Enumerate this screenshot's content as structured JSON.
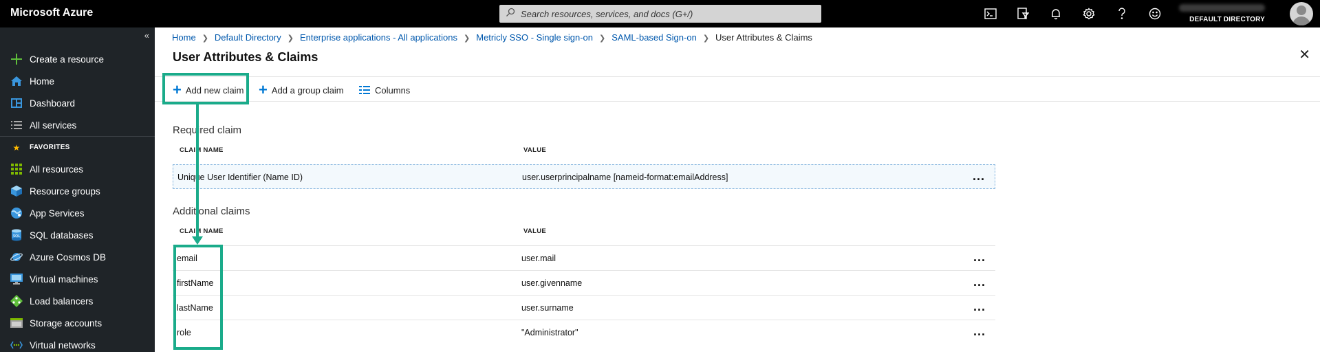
{
  "app": {
    "brand": "Microsoft Azure"
  },
  "search": {
    "placeholder": "Search resources, services, and docs (G+/)"
  },
  "header_icons": [
    "cloud-shell-icon",
    "directory-filter-icon",
    "notifications-icon",
    "settings-icon",
    "help-icon",
    "feedback-icon"
  ],
  "user": {
    "directory": "DEFAULT DIRECTORY"
  },
  "sidebar": {
    "collapse_glyph": "«",
    "items": [
      {
        "label": "Create a resource",
        "icon": "plus-icon"
      },
      {
        "label": "Home",
        "icon": "home-icon"
      },
      {
        "label": "Dashboard",
        "icon": "dashboard-icon"
      },
      {
        "label": "All services",
        "icon": "list-icon"
      }
    ],
    "favorites_label": "FAVORITES",
    "favorites": [
      {
        "label": "All resources",
        "icon": "grid-icon"
      },
      {
        "label": "Resource groups",
        "icon": "cube-icon"
      },
      {
        "label": "App Services",
        "icon": "globe-icon"
      },
      {
        "label": "SQL databases",
        "icon": "sql-icon"
      },
      {
        "label": "Azure Cosmos DB",
        "icon": "planet-icon"
      },
      {
        "label": "Virtual machines",
        "icon": "monitor-icon"
      },
      {
        "label": "Load balancers",
        "icon": "diamond-icon"
      },
      {
        "label": "Storage accounts",
        "icon": "storage-icon"
      },
      {
        "label": "Virtual networks",
        "icon": "network-icon"
      }
    ]
  },
  "breadcrumb": {
    "items": [
      "Home",
      "Default Directory",
      "Enterprise applications - All applications",
      "Metricly SSO - Single sign-on",
      "SAML-based Sign-on"
    ],
    "current": "User Attributes & Claims"
  },
  "page": {
    "title": "User Attributes & Claims",
    "close": "✕"
  },
  "commands": {
    "add_new_claim": "Add new claim",
    "add_group_claim": "Add a group claim",
    "columns": "Columns"
  },
  "required": {
    "title": "Required claim",
    "col_name": "CLAIM NAME",
    "col_value": "VALUE",
    "rows": [
      {
        "name": "Unique User Identifier (Name ID)",
        "value": "user.userprincipalname [nameid-format:emailAddress]"
      }
    ]
  },
  "additional": {
    "title": "Additional claims",
    "col_name": "CLAIM NAME",
    "col_value": "VALUE",
    "rows": [
      {
        "name": "email",
        "value": "user.mail"
      },
      {
        "name": "firstName",
        "value": "user.givenname"
      },
      {
        "name": "lastName",
        "value": "user.surname"
      },
      {
        "name": "role",
        "value": "\"Administrator\""
      }
    ]
  },
  "more_glyph": "...",
  "colors": {
    "accent": "#0078d4",
    "highlight": "#1aab8a",
    "sidebar_bg": "#1f2428",
    "link": "#0058ad"
  }
}
